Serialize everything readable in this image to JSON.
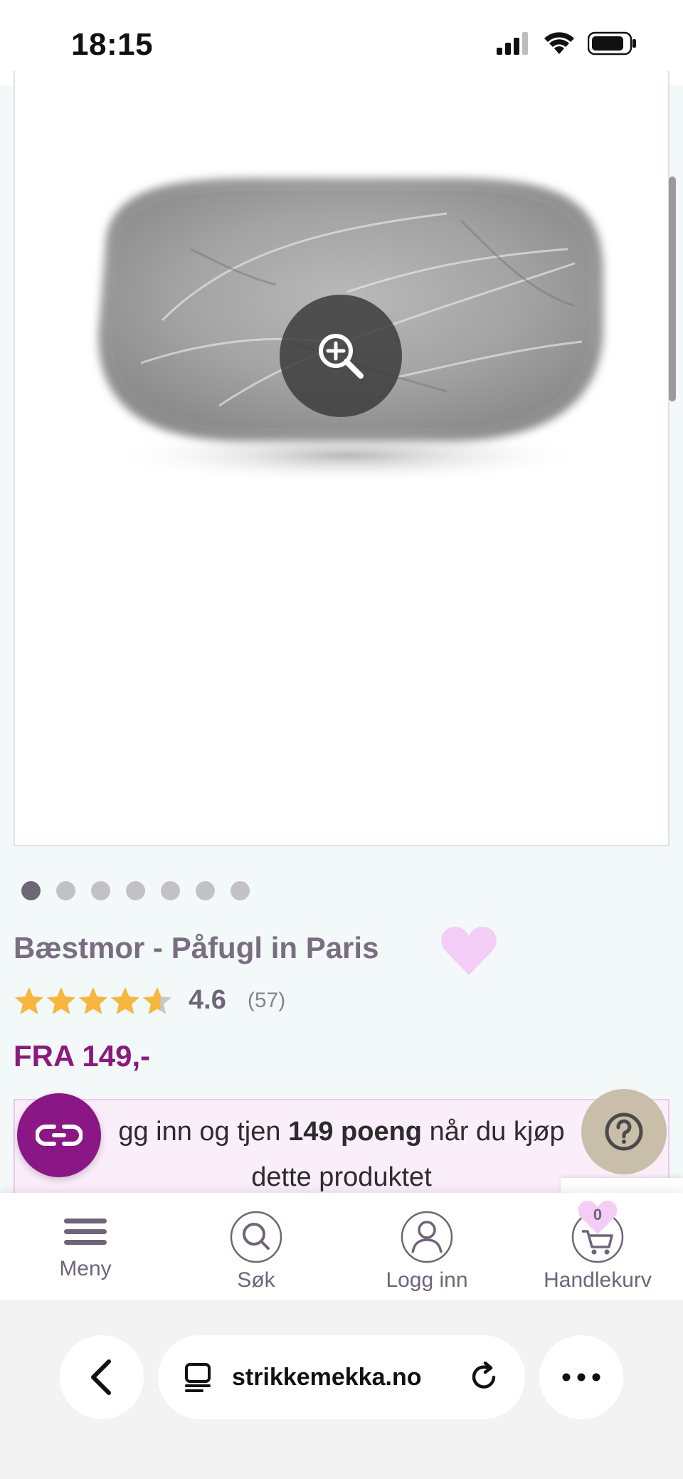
{
  "status_bar": {
    "time": "18:15"
  },
  "product": {
    "title": "Bæstmor - Påfugl in Paris",
    "rating_value": "4.6",
    "rating_stars": 4.6,
    "rating_count": "(57)",
    "price": "FRA 149,-",
    "image_count": 7,
    "active_image": 1
  },
  "points_banner": {
    "prefix": "gg inn og tjen ",
    "points": "149 poeng",
    "suffix": " når du kjøp",
    "line2": "dette produktet"
  },
  "bottom_nav": {
    "menu": "Meny",
    "search": "Søk",
    "login": "Logg inn",
    "cart": "Handlekurv",
    "cart_count": "0"
  },
  "browser": {
    "url": "strikkemekka.no"
  },
  "colors": {
    "brand_purple": "#8b1685",
    "price_purple": "#8a1a80",
    "star_yellow": "#f6b73c",
    "heart_pink": "#f3cdf6"
  },
  "icons": [
    "zoom-in-icon",
    "heart-icon",
    "star-icon",
    "loyalty-icon",
    "help-icon",
    "menu-icon",
    "search-icon",
    "user-icon",
    "cart-icon",
    "back-icon",
    "tabs-icon",
    "reload-icon",
    "more-icon"
  ]
}
